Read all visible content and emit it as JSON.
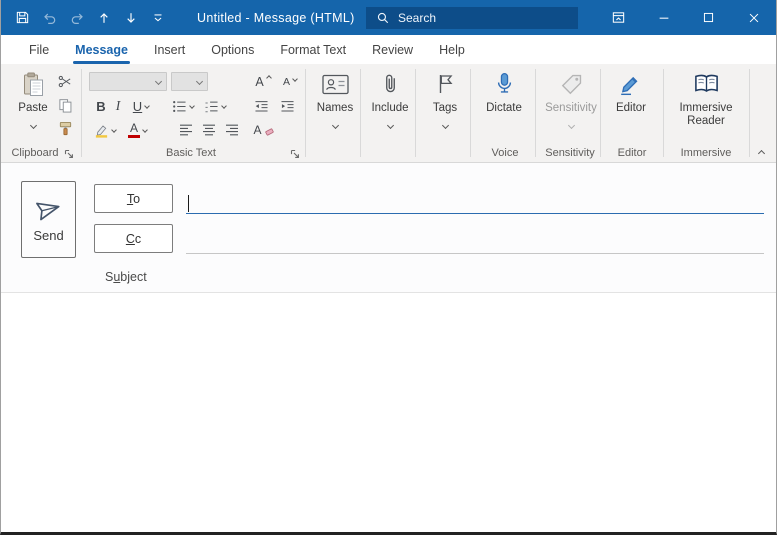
{
  "window": {
    "title": "Untitled  -  Message (HTML)"
  },
  "search": {
    "placeholder": "Search"
  },
  "tabs": [
    "File",
    "Message",
    "Insert",
    "Options",
    "Format Text",
    "Review",
    "Help"
  ],
  "selected_tab": "Message",
  "ribbon": {
    "paste": "Paste",
    "bold": "B",
    "italic": "I",
    "underline": "U",
    "grow_font": "A",
    "shrink_font": "A",
    "font_color": "A",
    "clear_formatting": "A",
    "names": "Names",
    "include": "Include",
    "tags": "Tags",
    "dictate": "Dictate",
    "sensitivity": "Sensitivity",
    "editor": "Editor",
    "immersive_reader": [
      "Immersive",
      "Reader"
    ],
    "group_labels": {
      "clipboard": "Clipboard",
      "basic_text": "Basic Text",
      "voice": "Voice",
      "sensitivity": "Sensitivity",
      "editor": "Editor",
      "immersive": "Immersive"
    }
  },
  "compose": {
    "send": "Send",
    "to_accel": "T",
    "to_rest": "o",
    "cc_accel": "C",
    "cc_rest": "c",
    "subject_pre": "S",
    "subject_accel": "u",
    "subject_rest": "bject",
    "to_value": "",
    "cc_value": "",
    "subject_value": "",
    "body": ""
  },
  "colors": {
    "titlebar_bg": "#1565ab",
    "search_bg": "#0d4d89",
    "accent": "#1a64ad",
    "ribbon_bg": "#f3f2f1",
    "focus_line": "#2b6cb0",
    "font_color_swatch": "#c00000"
  }
}
